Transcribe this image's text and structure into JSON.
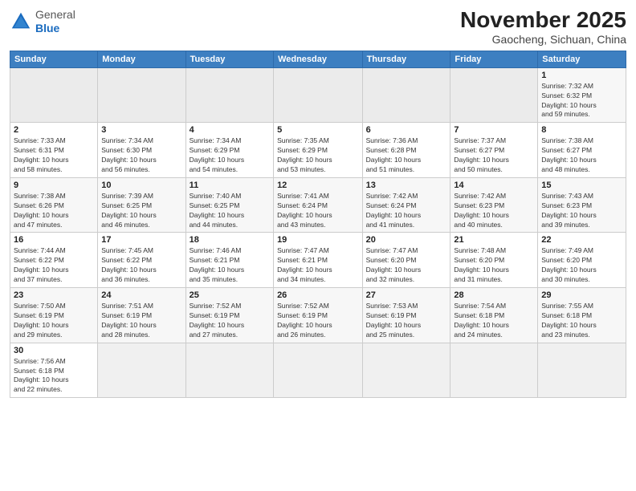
{
  "logo": {
    "general": "General",
    "blue": "Blue"
  },
  "header": {
    "month": "November 2025",
    "location": "Gaocheng, Sichuan, China"
  },
  "weekdays": [
    "Sunday",
    "Monday",
    "Tuesday",
    "Wednesday",
    "Thursday",
    "Friday",
    "Saturday"
  ],
  "weeks": [
    [
      {
        "day": "",
        "info": ""
      },
      {
        "day": "",
        "info": ""
      },
      {
        "day": "",
        "info": ""
      },
      {
        "day": "",
        "info": ""
      },
      {
        "day": "",
        "info": ""
      },
      {
        "day": "",
        "info": ""
      },
      {
        "day": "1",
        "info": "Sunrise: 7:32 AM\nSunset: 6:32 PM\nDaylight: 10 hours\nand 59 minutes."
      }
    ],
    [
      {
        "day": "2",
        "info": "Sunrise: 7:33 AM\nSunset: 6:31 PM\nDaylight: 10 hours\nand 58 minutes."
      },
      {
        "day": "3",
        "info": "Sunrise: 7:34 AM\nSunset: 6:30 PM\nDaylight: 10 hours\nand 56 minutes."
      },
      {
        "day": "4",
        "info": "Sunrise: 7:34 AM\nSunset: 6:29 PM\nDaylight: 10 hours\nand 54 minutes."
      },
      {
        "day": "5",
        "info": "Sunrise: 7:35 AM\nSunset: 6:29 PM\nDaylight: 10 hours\nand 53 minutes."
      },
      {
        "day": "6",
        "info": "Sunrise: 7:36 AM\nSunset: 6:28 PM\nDaylight: 10 hours\nand 51 minutes."
      },
      {
        "day": "7",
        "info": "Sunrise: 7:37 AM\nSunset: 6:27 PM\nDaylight: 10 hours\nand 50 minutes."
      },
      {
        "day": "8",
        "info": "Sunrise: 7:38 AM\nSunset: 6:27 PM\nDaylight: 10 hours\nand 48 minutes."
      }
    ],
    [
      {
        "day": "9",
        "info": "Sunrise: 7:38 AM\nSunset: 6:26 PM\nDaylight: 10 hours\nand 47 minutes."
      },
      {
        "day": "10",
        "info": "Sunrise: 7:39 AM\nSunset: 6:25 PM\nDaylight: 10 hours\nand 46 minutes."
      },
      {
        "day": "11",
        "info": "Sunrise: 7:40 AM\nSunset: 6:25 PM\nDaylight: 10 hours\nand 44 minutes."
      },
      {
        "day": "12",
        "info": "Sunrise: 7:41 AM\nSunset: 6:24 PM\nDaylight: 10 hours\nand 43 minutes."
      },
      {
        "day": "13",
        "info": "Sunrise: 7:42 AM\nSunset: 6:24 PM\nDaylight: 10 hours\nand 41 minutes."
      },
      {
        "day": "14",
        "info": "Sunrise: 7:42 AM\nSunset: 6:23 PM\nDaylight: 10 hours\nand 40 minutes."
      },
      {
        "day": "15",
        "info": "Sunrise: 7:43 AM\nSunset: 6:23 PM\nDaylight: 10 hours\nand 39 minutes."
      }
    ],
    [
      {
        "day": "16",
        "info": "Sunrise: 7:44 AM\nSunset: 6:22 PM\nDaylight: 10 hours\nand 37 minutes."
      },
      {
        "day": "17",
        "info": "Sunrise: 7:45 AM\nSunset: 6:22 PM\nDaylight: 10 hours\nand 36 minutes."
      },
      {
        "day": "18",
        "info": "Sunrise: 7:46 AM\nSunset: 6:21 PM\nDaylight: 10 hours\nand 35 minutes."
      },
      {
        "day": "19",
        "info": "Sunrise: 7:47 AM\nSunset: 6:21 PM\nDaylight: 10 hours\nand 34 minutes."
      },
      {
        "day": "20",
        "info": "Sunrise: 7:47 AM\nSunset: 6:20 PM\nDaylight: 10 hours\nand 32 minutes."
      },
      {
        "day": "21",
        "info": "Sunrise: 7:48 AM\nSunset: 6:20 PM\nDaylight: 10 hours\nand 31 minutes."
      },
      {
        "day": "22",
        "info": "Sunrise: 7:49 AM\nSunset: 6:20 PM\nDaylight: 10 hours\nand 30 minutes."
      }
    ],
    [
      {
        "day": "23",
        "info": "Sunrise: 7:50 AM\nSunset: 6:19 PM\nDaylight: 10 hours\nand 29 minutes."
      },
      {
        "day": "24",
        "info": "Sunrise: 7:51 AM\nSunset: 6:19 PM\nDaylight: 10 hours\nand 28 minutes."
      },
      {
        "day": "25",
        "info": "Sunrise: 7:52 AM\nSunset: 6:19 PM\nDaylight: 10 hours\nand 27 minutes."
      },
      {
        "day": "26",
        "info": "Sunrise: 7:52 AM\nSunset: 6:19 PM\nDaylight: 10 hours\nand 26 minutes."
      },
      {
        "day": "27",
        "info": "Sunrise: 7:53 AM\nSunset: 6:19 PM\nDaylight: 10 hours\nand 25 minutes."
      },
      {
        "day": "28",
        "info": "Sunrise: 7:54 AM\nSunset: 6:18 PM\nDaylight: 10 hours\nand 24 minutes."
      },
      {
        "day": "29",
        "info": "Sunrise: 7:55 AM\nSunset: 6:18 PM\nDaylight: 10 hours\nand 23 minutes."
      }
    ],
    [
      {
        "day": "30",
        "info": "Sunrise: 7:56 AM\nSunset: 6:18 PM\nDaylight: 10 hours\nand 22 minutes."
      },
      {
        "day": "",
        "info": ""
      },
      {
        "day": "",
        "info": ""
      },
      {
        "day": "",
        "info": ""
      },
      {
        "day": "",
        "info": ""
      },
      {
        "day": "",
        "info": ""
      },
      {
        "day": "",
        "info": ""
      }
    ]
  ]
}
